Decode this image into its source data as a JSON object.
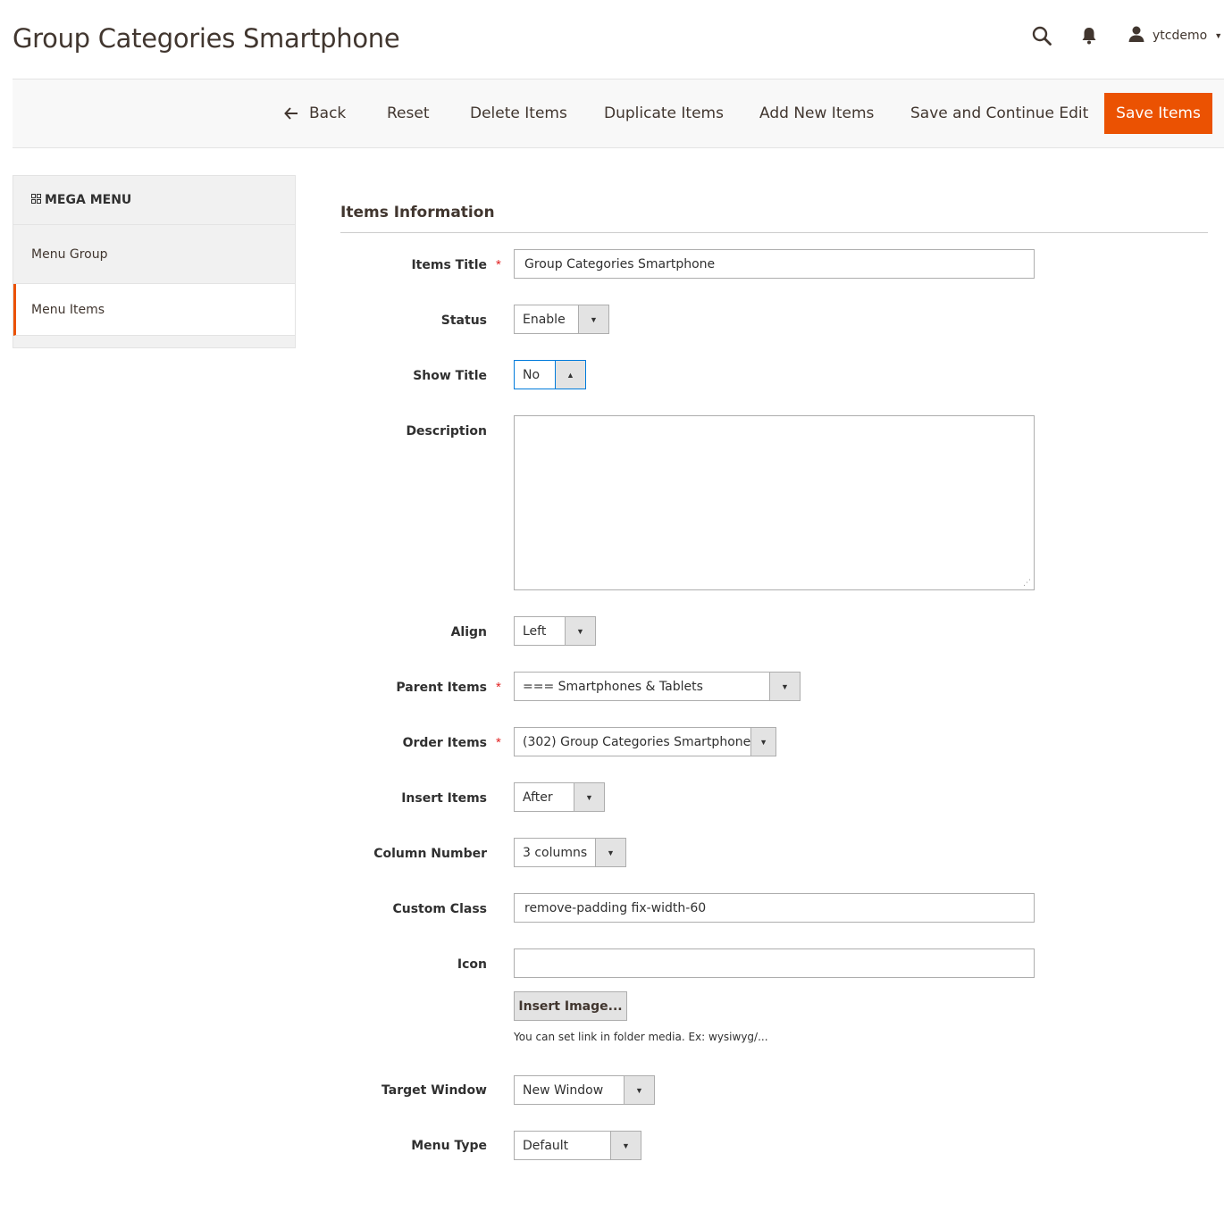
{
  "header": {
    "title": "Group Categories Smartphone",
    "user_name": "ytcdemo",
    "search_icon": "search-icon",
    "bell_icon": "bell-icon",
    "user_icon": "user-icon"
  },
  "actions": {
    "back": "Back",
    "reset": "Reset",
    "delete": "Delete Items",
    "duplicate": "Duplicate Items",
    "add_new": "Add New Items",
    "save_continue": "Save and Continue Edit",
    "save": "Save Items"
  },
  "sidebar": {
    "heading": "MEGA MENU",
    "items": [
      {
        "label": "Menu Group",
        "active": false
      },
      {
        "label": "Menu Items",
        "active": true
      }
    ]
  },
  "form": {
    "section_title": "Items Information",
    "items_title": {
      "label": "Items Title",
      "value": "Group Categories Smartphone",
      "required": "*"
    },
    "status": {
      "label": "Status",
      "value": "Enable"
    },
    "show_title": {
      "label": "Show Title",
      "value": "No"
    },
    "description": {
      "label": "Description",
      "value": ""
    },
    "align": {
      "label": "Align",
      "value": "Left"
    },
    "parent_items": {
      "label": "Parent Items",
      "value": "=== Smartphones & Tablets",
      "required": "*"
    },
    "order_items": {
      "label": "Order Items",
      "value": "(302) Group Categories Smartphone",
      "required": "*"
    },
    "insert_items": {
      "label": "Insert Items",
      "value": "After"
    },
    "column_number": {
      "label": "Column Number",
      "value": "3 columns"
    },
    "custom_class": {
      "label": "Custom Class",
      "value": "remove-padding fix-width-60"
    },
    "icon": {
      "label": "Icon",
      "value": "",
      "button": "Insert Image...",
      "note": "You can set link in folder media. Ex: wysiwyg/..."
    },
    "target_window": {
      "label": "Target Window",
      "value": "New Window"
    },
    "menu_type": {
      "label": "Menu Type",
      "value": "Default"
    }
  },
  "colors": {
    "accent": "#eb5202",
    "required": "#e22626",
    "focus": "#007bdb"
  }
}
